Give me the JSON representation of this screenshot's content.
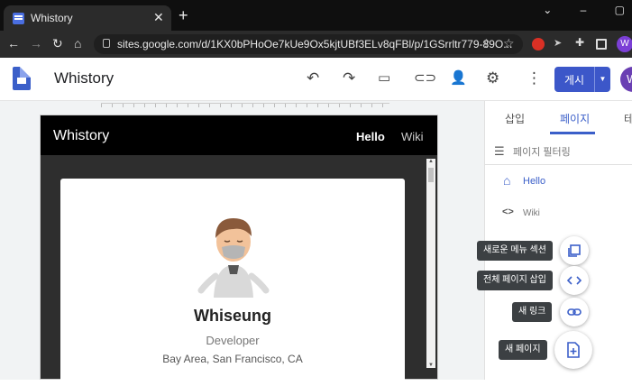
{
  "browser": {
    "tab_title": "Whistory",
    "tab_close": "✕",
    "new_tab": "+",
    "url": "sites.google.com/d/1KX0bPHoOe7kUe9Ox5kjtUBf3ELv8qFBl/p/1GSrrltr779-89O...",
    "profile_initial": "W",
    "window_minimize": "⌄",
    "window_restore": "–",
    "window_max": "▢"
  },
  "header": {
    "site_title": "Whistory",
    "publish_label": "게시",
    "user_initial": "W"
  },
  "preview": {
    "brand": "Whistory",
    "nav": [
      "Hello",
      "Wiki"
    ],
    "profile": {
      "name": "Whiseung",
      "role": "Developer",
      "location": "Bay Area, San Francisco, CA"
    }
  },
  "panel": {
    "tabs": [
      "삽입",
      "페이지",
      "테"
    ],
    "filter_placeholder": "페이지 필터링",
    "pages": [
      {
        "label": "Hello",
        "active": true
      },
      {
        "label": "Wiki",
        "active": false
      }
    ]
  },
  "fab_menu": {
    "items": [
      {
        "label": "새로운 메뉴 섹션",
        "icon": "copy-section-icon"
      },
      {
        "label": "전체 페이지 삽입",
        "icon": "code-icon"
      },
      {
        "label": "새 링크",
        "icon": "link-icon"
      },
      {
        "label": "새 페이지",
        "icon": "new-page-icon"
      }
    ]
  },
  "colors": {
    "accent": "#3b5fc9",
    "nav_bg": "#000000",
    "page_bg": "#2e2e2e"
  }
}
